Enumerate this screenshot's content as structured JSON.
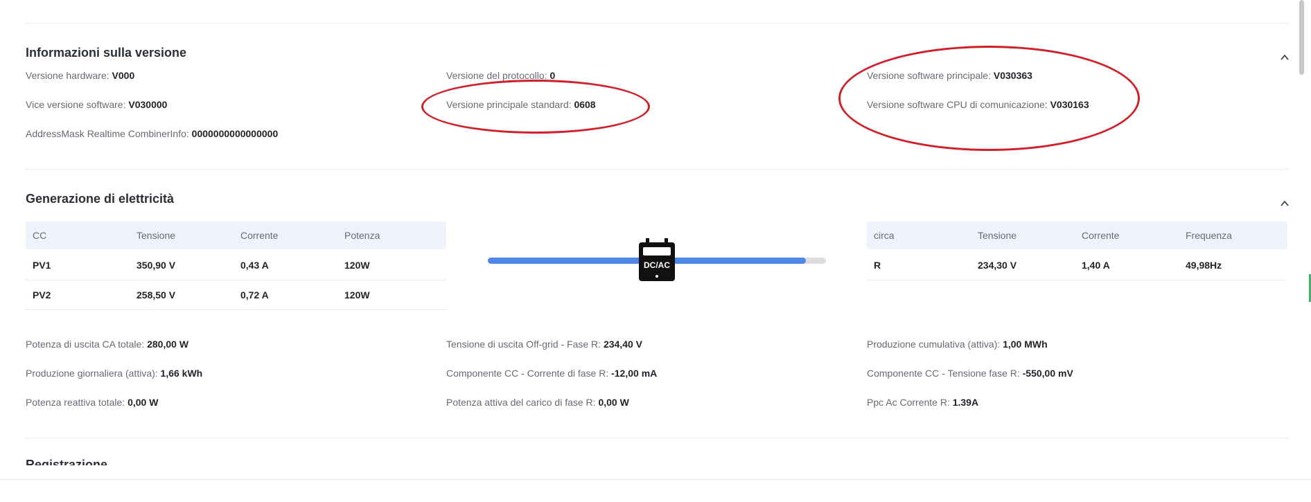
{
  "version_section": {
    "title": "Informazioni sulla versione",
    "items": [
      {
        "label": "Versione hardware:",
        "value": "V000"
      },
      {
        "label": "Versione del protocollo:",
        "value": "0"
      },
      {
        "label": "Versione software principale:",
        "value": "V030363"
      },
      {
        "label": "Vice versione software:",
        "value": "V030000"
      },
      {
        "label": "Versione principale standard:",
        "value": "0608"
      },
      {
        "label": "Versione software CPU di comunicazione:",
        "value": "V030163"
      },
      {
        "label": "AddressMask Realtime CombinerInfo:",
        "value": "0000000000000000"
      }
    ]
  },
  "generation_section": {
    "title": "Generazione di elettricità",
    "dc_table": {
      "headers": [
        "CC",
        "Tensione",
        "Corrente",
        "Potenza"
      ],
      "rows": [
        [
          "PV1",
          "350,90 V",
          "0,43 A",
          "120W"
        ],
        [
          "PV2",
          "258,50 V",
          "0,72 A",
          "120W"
        ]
      ]
    },
    "converter": {
      "label": "DC/AC",
      "flow_fraction": 0.94
    },
    "ac_table": {
      "headers": [
        "circa",
        "Tensione",
        "Corrente",
        "Frequenza"
      ],
      "rows": [
        [
          "R",
          "234,30 V",
          "1,40 A",
          "49,98Hz"
        ]
      ]
    },
    "items": [
      {
        "label": "Potenza di uscita CA totale:",
        "value": "280,00 W"
      },
      {
        "label": "Tensione di uscita Off-grid - Fase R:",
        "value": "234,40 V"
      },
      {
        "label": "Produzione cumulativa (attiva):",
        "value": "1,00 MWh"
      },
      {
        "label": "Produzione giornaliera (attiva):",
        "value": "1,66 kWh"
      },
      {
        "label": "Componente CC - Corrente di fase R:",
        "value": "-12,00 mA"
      },
      {
        "label": "Componente CC - Tensione fase R:",
        "value": "-550,00 mV"
      },
      {
        "label": "Potenza reattiva totale:",
        "value": "0,00 W"
      },
      {
        "label": "Potenza attiva del carico di fase R:",
        "value": "0,00 W"
      },
      {
        "label": "Ppc Ac Corrente R:",
        "value": "1.39A"
      }
    ]
  },
  "next_section": {
    "title": "Registrazione"
  },
  "annotation_color": "#d0202a",
  "accent_color": "#4f87e8"
}
